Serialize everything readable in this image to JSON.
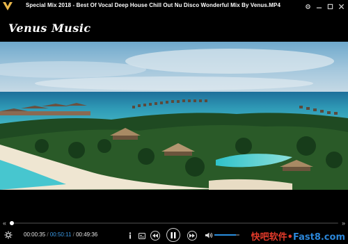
{
  "window": {
    "title": "Special Mix 2018 - Best Of Vocal Deep House Chill Out Nu Disco Wonderful Mix By Venus.MP4",
    "controls": [
      "settings-icon",
      "minimize-icon",
      "maximize-icon",
      "close-icon"
    ]
  },
  "video": {
    "watermark": "Venus Music",
    "scene": "aerial-tropical-island"
  },
  "seekbar": {
    "left_glyph": "«",
    "right_glyph": "»",
    "progress_percent": 0.7,
    "accent_color": "#2a8fe0"
  },
  "playback": {
    "current_time": "00:00:35",
    "separator": "/",
    "ab_time": "00:50:11",
    "duration": "00:49:36",
    "state": "playing",
    "volume_percent": 85
  },
  "buttons": {
    "settings": "gear-icon",
    "info": "info-icon",
    "subtitle": "subtitle-icon",
    "previous": "previous-icon",
    "play_pause": "pause-icon",
    "next": "next-icon",
    "volume": "volume-icon"
  },
  "branding": {
    "cn": "快吧软件",
    "dot": "•",
    "en": "Fast8.com"
  }
}
